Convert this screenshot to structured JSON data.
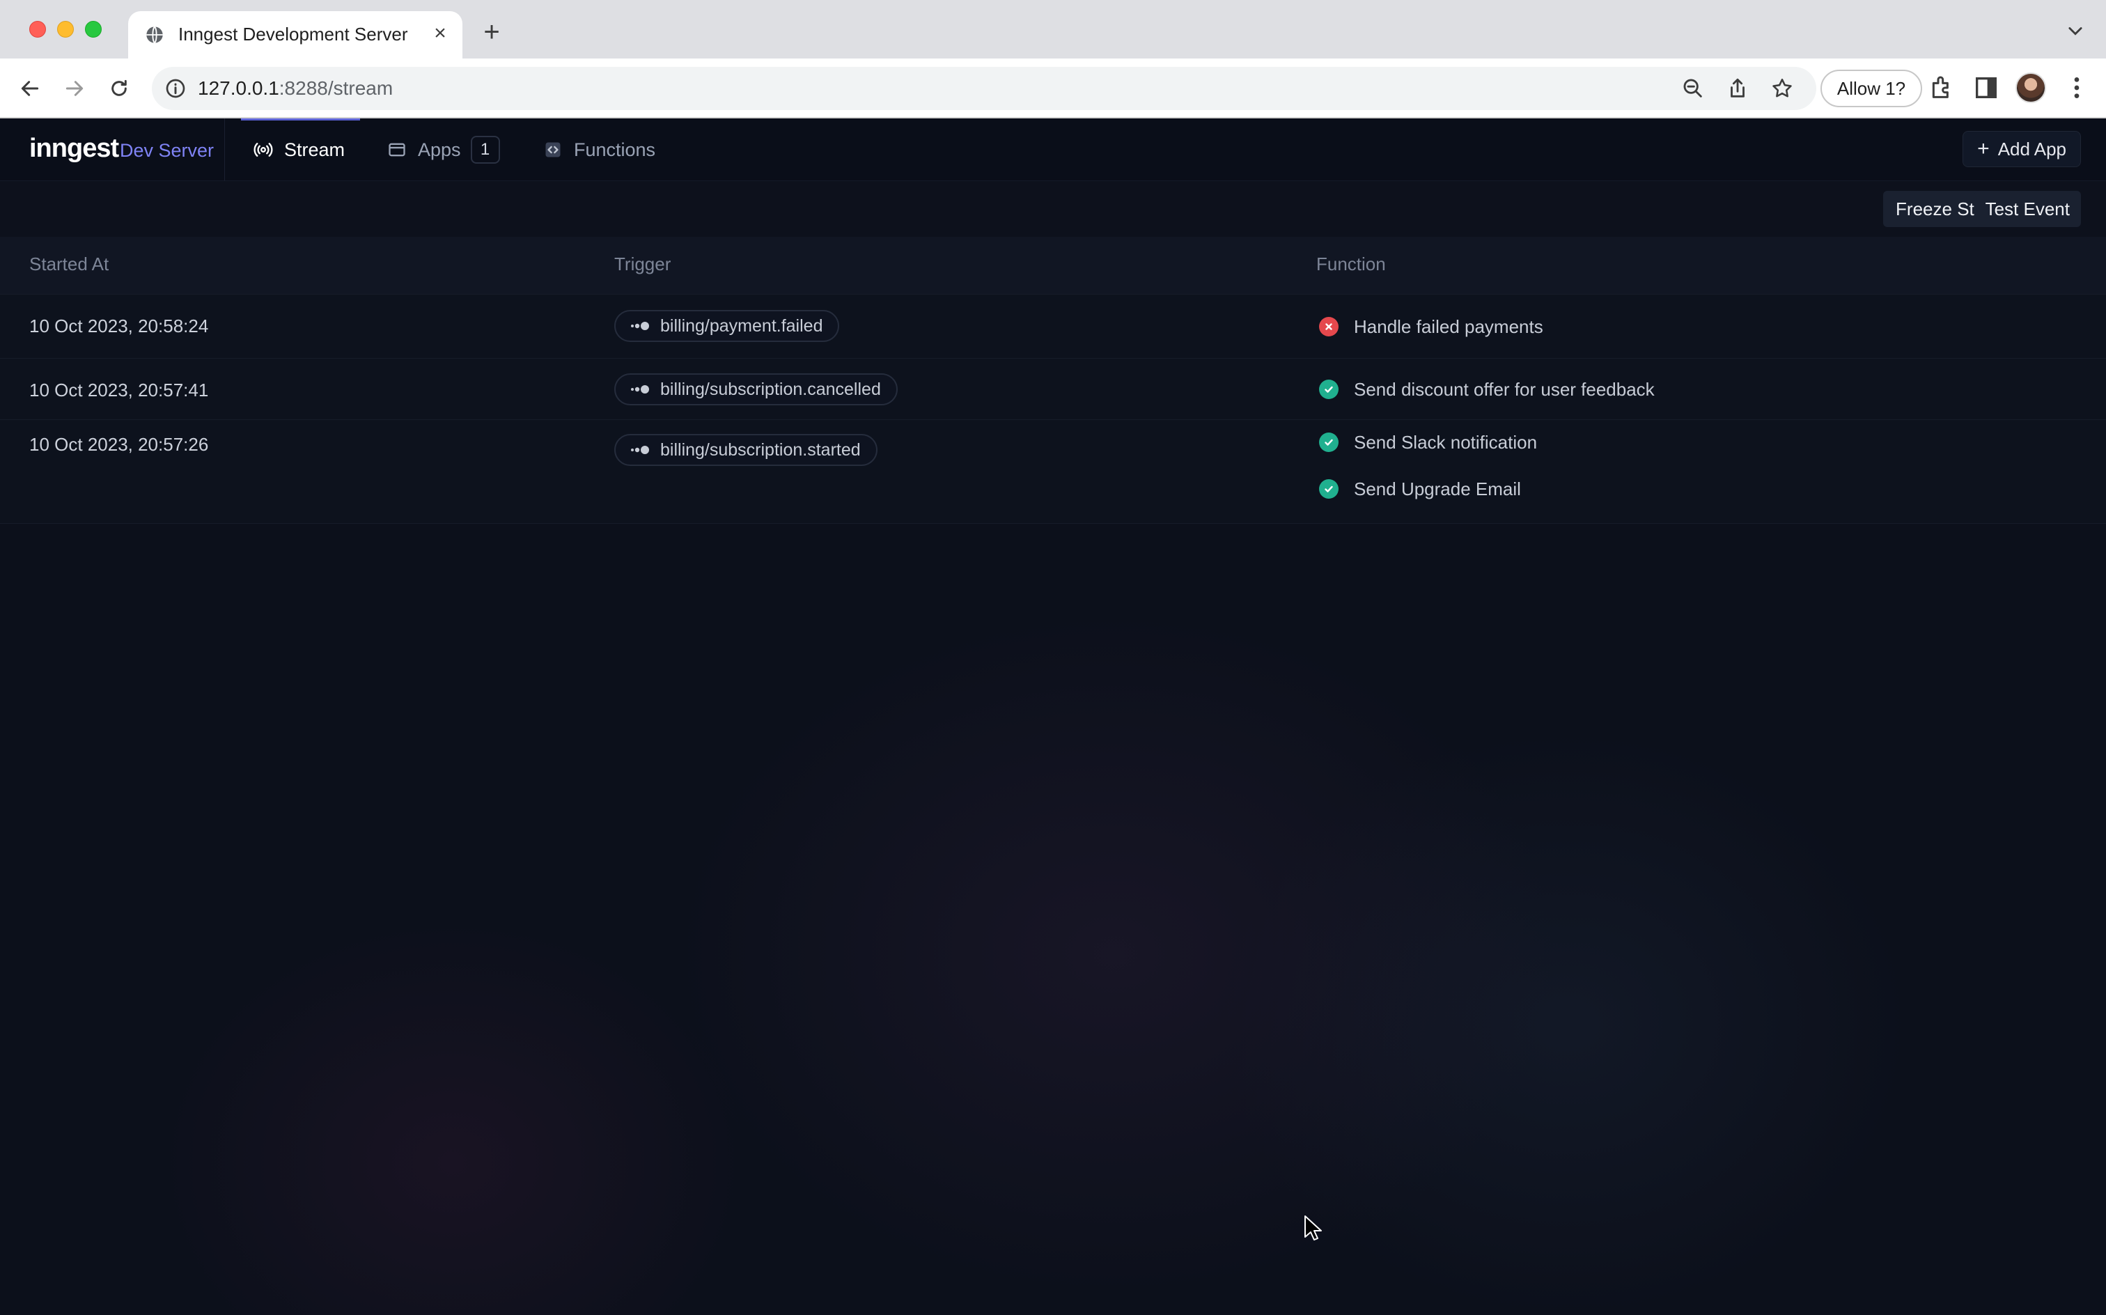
{
  "browser": {
    "tab_title": "Inngest Development Server",
    "url_host": "127.0.0.1",
    "url_path": ":8288/stream",
    "allow_label": "Allow 1?"
  },
  "app": {
    "logo": "inngest",
    "logo_sub": "Dev Server",
    "nav": {
      "stream": "Stream",
      "apps": "Apps",
      "apps_count": "1",
      "functions": "Functions"
    },
    "add_app": "Add App",
    "freeze_stream": "Freeze Stream",
    "test_event": "Test Event"
  },
  "table": {
    "headers": {
      "started_at": "Started At",
      "trigger": "Trigger",
      "function": "Function"
    },
    "rows": [
      {
        "started_at": "10 Oct 2023, 20:58:24",
        "trigger": "billing/payment.failed",
        "functions": [
          {
            "name": "Handle failed payments",
            "status": "failed"
          }
        ]
      },
      {
        "started_at": "10 Oct 2023, 20:57:41",
        "trigger": "billing/subscription.cancelled",
        "functions": [
          {
            "name": "Send discount offer for user feedback",
            "status": "completed"
          }
        ]
      },
      {
        "started_at": "10 Oct 2023, 20:57:26",
        "trigger": "billing/subscription.started",
        "functions": [
          {
            "name": "Send Slack notification",
            "status": "completed"
          },
          {
            "name": "Send Upgrade Email",
            "status": "completed"
          }
        ]
      }
    ]
  },
  "colors": {
    "accent": "#7f83f5",
    "status_failed": "#e5484d",
    "status_completed": "#20b08f",
    "background": "#0c101b"
  }
}
